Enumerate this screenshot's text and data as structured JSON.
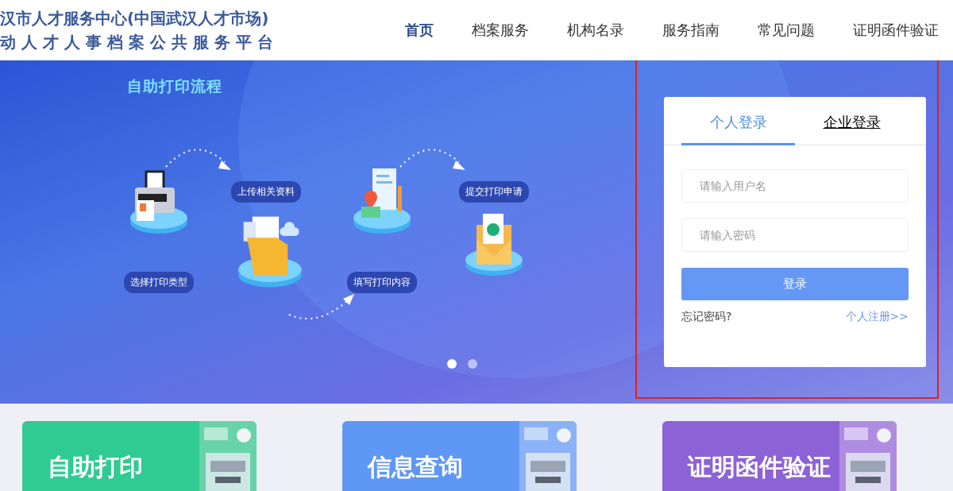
{
  "header": {
    "logo_lines": [
      "汉市人才服务中心(中国武汉人才市场)",
      "动人才人事档案公共服务平台"
    ],
    "nav": [
      {
        "label": "首页",
        "selected": true
      },
      {
        "label": "档案服务",
        "selected": false
      },
      {
        "label": "机构名录",
        "selected": false
      },
      {
        "label": "服务指南",
        "selected": false
      },
      {
        "label": "常见问题",
        "selected": false
      },
      {
        "label": "证明函件验证",
        "selected": false
      }
    ]
  },
  "banner": {
    "title": "自助打印流程",
    "steps": [
      {
        "label": "选择打印类型",
        "kind": "printer"
      },
      {
        "label": "上传相关资料",
        "kind": "folder"
      },
      {
        "label": "填写打印内容",
        "kind": "document"
      },
      {
        "label": "提交打印申请",
        "kind": "envelope"
      }
    ],
    "dots": [
      {
        "selected": true
      },
      {
        "selected": false
      }
    ]
  },
  "login": {
    "tabs": [
      {
        "label": "个人登录",
        "selected": true
      },
      {
        "label": "企业登录",
        "selected": false
      }
    ],
    "fields": [
      {
        "placeholder": "请输入用户名"
      },
      {
        "placeholder": "请输入密码"
      }
    ],
    "button": "登录",
    "forgot": "忘记密码?",
    "register": "个人注册>>"
  },
  "cards": [
    {
      "title": "自助打印",
      "color": "#2fcb93"
    },
    {
      "title": "信息查询",
      "color": "#5f97f5"
    },
    {
      "title": "证明函件验证",
      "color": "#8d62d6"
    }
  ]
}
